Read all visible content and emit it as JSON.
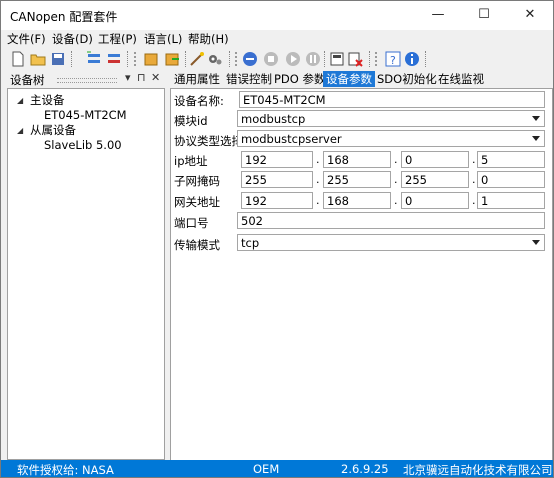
{
  "window": {
    "title": "CANopen 配置套件",
    "minimize": "—",
    "maximize": "☐",
    "close": "✕"
  },
  "menu": [
    "文件(F)",
    "设备(D)",
    "工程(P)",
    "语言(L)",
    "帮助(H)"
  ],
  "toolbar": {
    "icons": [
      "new-file-icon",
      "open-folder-icon",
      "save-icon",
      "add-node-icon",
      "remove-node-icon",
      "import-icon",
      "export-icon",
      "wizard-icon",
      "settings-icon",
      "connect-icon",
      "stop-icon",
      "play-icon",
      "pause-icon",
      "download-icon",
      "delete-icon",
      "info-icon",
      "help-icon"
    ]
  },
  "sidebar": {
    "title": "设备树",
    "pin": "▾ ⊓ ✕",
    "tree": [
      {
        "label": "主设备",
        "expanded": true
      },
      {
        "label": "ET045-MT2CM",
        "child": true
      },
      {
        "label": "从属设备",
        "expanded": true
      },
      {
        "label": "SlaveLib 5.00",
        "child": true
      }
    ]
  },
  "tabs": [
    "通用属性",
    "错误控制",
    "PDO 参数",
    "设备参数",
    "SDO初始化",
    "在线监视"
  ],
  "active_tab": "设备参数",
  "form": {
    "device_name": {
      "label": "设备名称:",
      "value": "ET045-MT2CM"
    },
    "module_id": {
      "label": "模块id",
      "value": "modbustcp"
    },
    "protocol": {
      "label": "协议类型选择",
      "value": "modbustcpserver"
    },
    "ip": {
      "label": "ip地址",
      "parts": [
        "192",
        "168",
        "0",
        "5"
      ]
    },
    "mask": {
      "label": "子网掩码",
      "parts": [
        "255",
        "255",
        "255",
        "0"
      ]
    },
    "gateway": {
      "label": "网关地址",
      "parts": [
        "192",
        "168",
        "0",
        "1"
      ]
    },
    "port": {
      "label": "端口号",
      "value": "502"
    },
    "transport": {
      "label": "传输模式",
      "value": "tcp"
    }
  },
  "status": {
    "license": "软件授权给:   NASA",
    "edition": "OEM",
    "version": "2.6.9.25",
    "company": "北京骥远自动化技术有限公司"
  },
  "colors": {
    "accent": "#0078d7",
    "tab_active": "#1e78d6"
  }
}
